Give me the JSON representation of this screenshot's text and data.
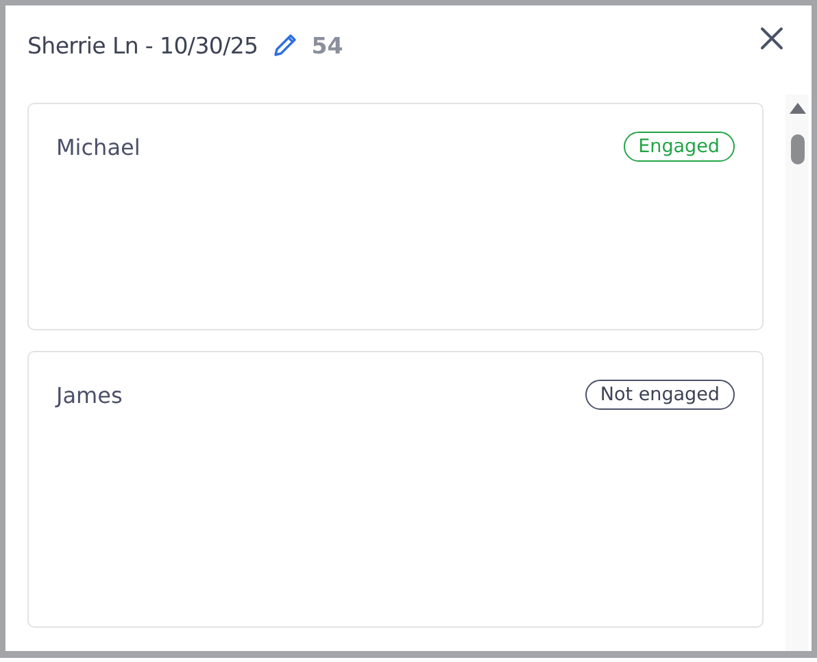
{
  "header": {
    "title": "Sherrie Ln - 10/30/25",
    "count": "54"
  },
  "contacts": [
    {
      "name": "Michael",
      "status": {
        "kind": "engaged",
        "label": "Engaged"
      }
    },
    {
      "name": "James",
      "status": {
        "kind": "not_engaged",
        "label": "Not engaged"
      }
    }
  ]
}
